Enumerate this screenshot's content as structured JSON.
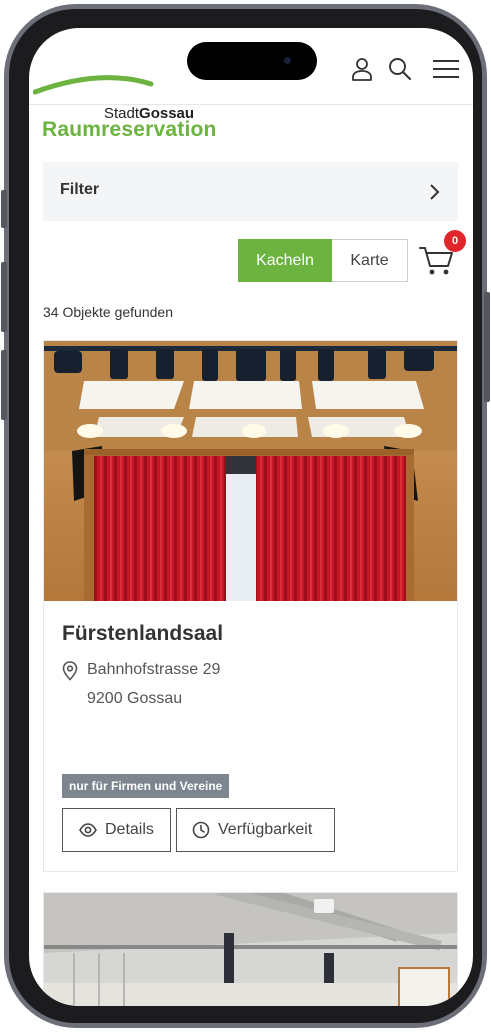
{
  "header": {
    "logo_text_light": "Stadt",
    "logo_text_bold": "Gossau",
    "icons": [
      "user-icon",
      "search-icon",
      "menu-icon"
    ]
  },
  "page": {
    "title": "Raumreservation"
  },
  "filter": {
    "label": "Filter"
  },
  "view_toggle": {
    "options": [
      "Kacheln",
      "Karte"
    ],
    "selected": "Kacheln"
  },
  "cart": {
    "count": "0"
  },
  "results": {
    "count_text": "34 Objekte gefunden"
  },
  "cards": [
    {
      "title": "Fürstenlandsaal",
      "address_line1": "Bahnhofstrasse 29",
      "address_line2": "9200 Gossau",
      "badge": "nur für Firmen und Vereine",
      "details_label": "Details",
      "availability_label": "Verfügbarkeit"
    }
  ],
  "colors": {
    "brand_green": "#6cb33f",
    "badge_gray": "#7d858e",
    "cart_badge_red": "#e0252b"
  }
}
